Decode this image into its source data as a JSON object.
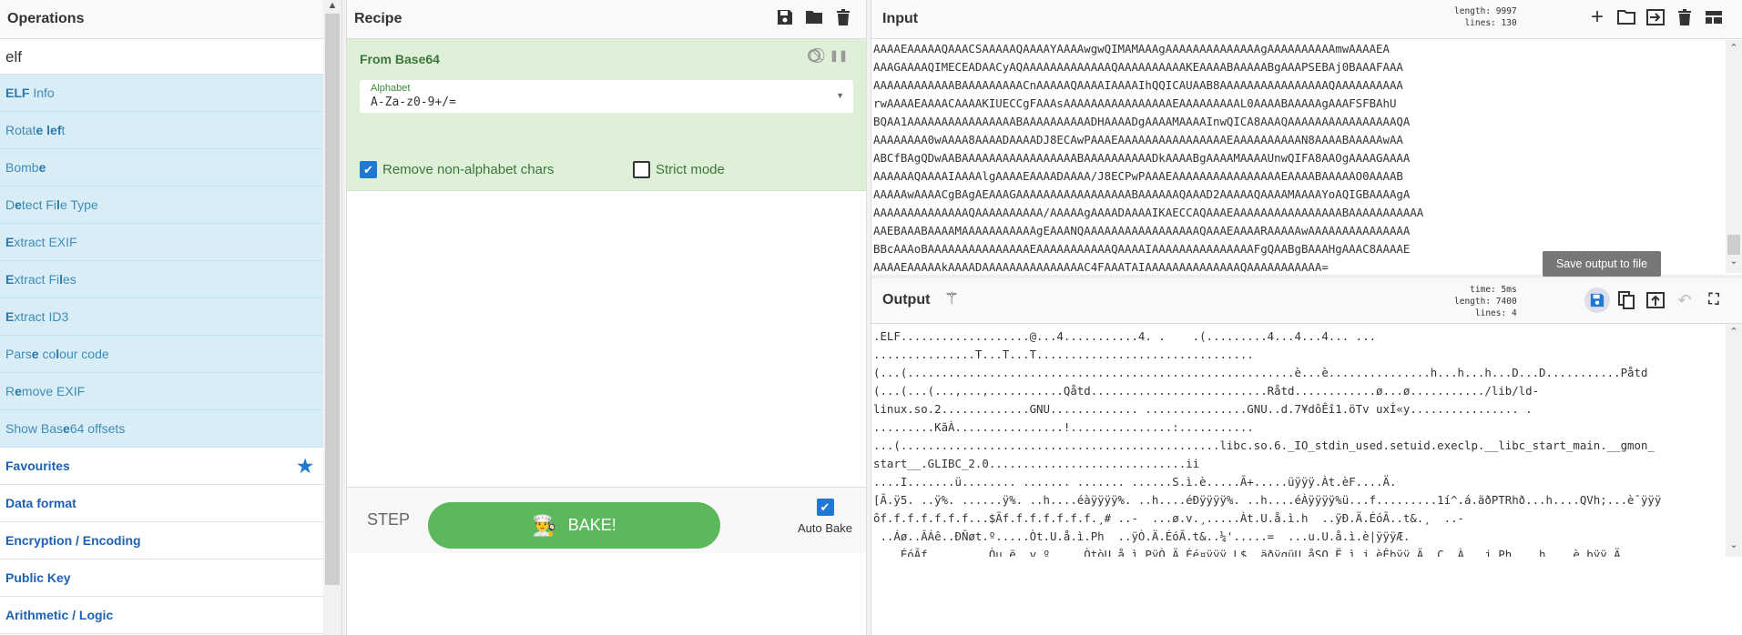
{
  "operations": {
    "title": "Operations",
    "search_value": "elf",
    "results": [
      {
        "segments": [
          {
            "text": "ELF",
            "match": true
          },
          {
            "text": " Info",
            "match": false
          }
        ]
      },
      {
        "segments": [
          {
            "text": "Rotat",
            "match": false
          },
          {
            "text": "e",
            "match": true
          },
          {
            "text": " ",
            "match": false
          },
          {
            "text": "lef",
            "match": true
          },
          {
            "text": "t",
            "match": false
          }
        ]
      },
      {
        "segments": [
          {
            "text": "Bomb",
            "match": false
          },
          {
            "text": "e",
            "match": true
          }
        ]
      },
      {
        "segments": [
          {
            "text": "D",
            "match": false
          },
          {
            "text": "e",
            "match": true
          },
          {
            "text": "tect Fi",
            "match": false
          },
          {
            "text": "l",
            "match": true
          },
          {
            "text": "e Type",
            "match": false
          }
        ]
      },
      {
        "segments": [
          {
            "text": "E",
            "match": true
          },
          {
            "text": "xtract EXIF",
            "match": false
          }
        ]
      },
      {
        "segments": [
          {
            "text": "E",
            "match": true
          },
          {
            "text": "xtract Fi",
            "match": false
          },
          {
            "text": "l",
            "match": true
          },
          {
            "text": "es",
            "match": false
          }
        ]
      },
      {
        "segments": [
          {
            "text": "E",
            "match": true
          },
          {
            "text": "xtract ID3",
            "match": false
          }
        ]
      },
      {
        "segments": [
          {
            "text": "Pars",
            "match": false
          },
          {
            "text": "e",
            "match": true
          },
          {
            "text": " co",
            "match": false
          },
          {
            "text": "l",
            "match": true
          },
          {
            "text": "our code",
            "match": false
          }
        ]
      },
      {
        "segments": [
          {
            "text": "R",
            "match": false
          },
          {
            "text": "e",
            "match": true
          },
          {
            "text": "move EXIF",
            "match": false
          }
        ]
      },
      {
        "segments": [
          {
            "text": "Show Bas",
            "match": false
          },
          {
            "text": "e",
            "match": true
          },
          {
            "text": "64 offsets",
            "match": false
          }
        ]
      }
    ],
    "categories": [
      "Favourites",
      "Data format",
      "Encryption / Encoding",
      "Public Key",
      "Arithmetic / Logic"
    ]
  },
  "recipe": {
    "title": "Recipe",
    "operation": {
      "title": "From Base64",
      "alphabet_label": "Alphabet",
      "alphabet_value": "A-Za-z0-9+/=",
      "remove_non_alphabet_label": "Remove non-alphabet chars",
      "remove_non_alphabet_checked": true,
      "strict_mode_label": "Strict mode",
      "strict_mode_checked": false
    },
    "step_label": "STEP",
    "bake_label": "BAKE!",
    "auto_bake_label": "Auto Bake",
    "auto_bake_checked": true
  },
  "input": {
    "title": "Input",
    "length_label": "length:",
    "length": "9997",
    "lines_label": "lines:",
    "lines": "130",
    "text": [
      "AAAAEAAAAAQAAACSAAAAAQAAAAYAAAAwgwQIMAMAAAgAAAAAAAAAAAAAAgAAAAAAAAAAmwAAAAEA",
      "AAAGAAAAQIMECEADAACyAQAAAAAAAAAAAAAQAAAAAAAAAAKEAAAABAAAAABgAAAPSEBAj0BAAAFAAA",
      "AAAAAAAAAAAABAAAAAAAAACnAAAAAQAAAAIAAAAIhQQICAUAAB8AAAAAAAAAAAAAAAAQAAAAAAAAAA",
      "rwAAAAEAAAACAAAAKIUECCgFAAAsAAAAAAAAAAAAAAAAEAAAAAAAAAL0AAAABAAAAAgAAAFSFBAhU",
      "BQAA1AAAAAAAAAAAAAAAABAAAAAAAAAADHAAAADgAAAAMAAAAInwQICA8AAAQAAAAAAAAAAAAAAAAQA",
      "AAAAAAAA0wAAAA8AAAADAAAADJ8ECAwPAAAEAAAAAAAAAAAAAAAAEAAAAAAAAAAN8AAAABAAAAAwAA",
      "ABCfBAgQDwAABAAAAAAAAAAAAAAAAABAAAAAAAAAADkAAAABgAAAAMAAAAUnwQIFA8AAOgAAAAGAAAA",
      "AAAAAAQAAAAIAAAAlgAAAAEAAAADAAAA/J8ECPwPAAAEAAAAAAAAAAAAAAAAEAAAABAAAAAO0AAAAB",
      "AAAAAwAAAACgBAgAEAAAGAAAAAAAAAAAAAAAAABAAAAAAQAAAD2AAAAAQAAAAMAAAAYoAQIGBAAAAgA",
      "AAAAAAAAAAAAAAQAAAAAAAAAA/AAAAAgAAAADAAAAIKAECCAQAAAEAAAAAAAAAAAAAAAABAAAAAAAAAAA",
      "AAEBAAABAAAAMAAAAAAAAAAAgEAAANQAAAAAAAAAAAAAAAAAQAAAEAAAARAAAAAwAAAAAAAAAAAAAAA",
      "BBcAAAoBAAAAAAAAAAAAAAAEAAAAAAAAAAAQAAAAIAAAAAAAAAAAAAAAFgQAABgBAAAHgAAAC8AAAAE",
      "AAAAEAAAAAkAAAADAAAAAAAAAAAAAAAC4FAAATAIAAAAAAAAAAAAAAQAAAAAAAAAAA="
    ]
  },
  "output": {
    "title": "Output",
    "time_label": "time:",
    "time": "5ms",
    "length_label": "length:",
    "length": "7400",
    "lines_label": "lines:",
    "lines": "4",
    "tooltip": "Save output to file",
    "text": [
      ".ELF...................@...4...........4. .    .(.........4...4...4... ...",
      "...............T...T...T................................",
      "(...(.........................................................è...è...............h...h...h...D...D...........Påtd",
      "(...(...(...,...,...........Qåtd..........................Råtd............ø...ø.........../lib/ld-",
      "linux.so.2.............GNU............. ...............GNU..d.7¥dôÊî1.öTv uxÍ«y................ .",
      ".........KãÀ................!...............:...........",
      "...(...............................................libc.so.6._IO_stdin_used.setuid.execlp.__libc_start_main.__gmon_",
      "start__.GLIBC_2.0.............................ii",
      "....I.......ü........ ....... ....... ......S.ì.è.....Ã+.....üÿÿÿ.Àt.èF....Ä.",
      "[Ã.ÿ5. ..ÿ%. ......ÿ%. ..h....éàÿÿÿÿ%. ..h....éÐÿÿÿÿ%. ..h....éÀÿÿÿÿ%ü...f.........1í^.á.äðPTRhð...h....QVh;...è¯ÿÿÿ",
      "ôf.f.f.f.f.f.f...$Ãf.f.f.f.f.f.f.¸# ..-  ...ø.v.¸.....Àt.U.å.ì.h  ..ÿÐ.Ä.ÉóÃ..t&.¸  ..-",
      " ..Áø..ÂÁê..ÐÑøt.º.....Òt.U.å.ì.Ph  ..ÿÒ.Ä.ÉóÃ.t&..¼'.....=  ...u.U.å.ì.è|ÿÿÿÆ.",
      " ...ÉóÃf. .......Òu.ë..v.º.....ÒtòU.å.ì.PÿÒ.Ä.Éé¤ÿÿÿ.L$..äðÿqüU.åSQ.Ë.ì.j.èÊþÿÿ.Ä..C..À...j.Ph....h....è.þÿÿ.Ä. ...."
    ]
  },
  "colors": {
    "accent": "#1e78d4",
    "bake": "#5cb85c",
    "recipe_bg": "#dff0d8",
    "op_bg": "#d9edf7"
  }
}
